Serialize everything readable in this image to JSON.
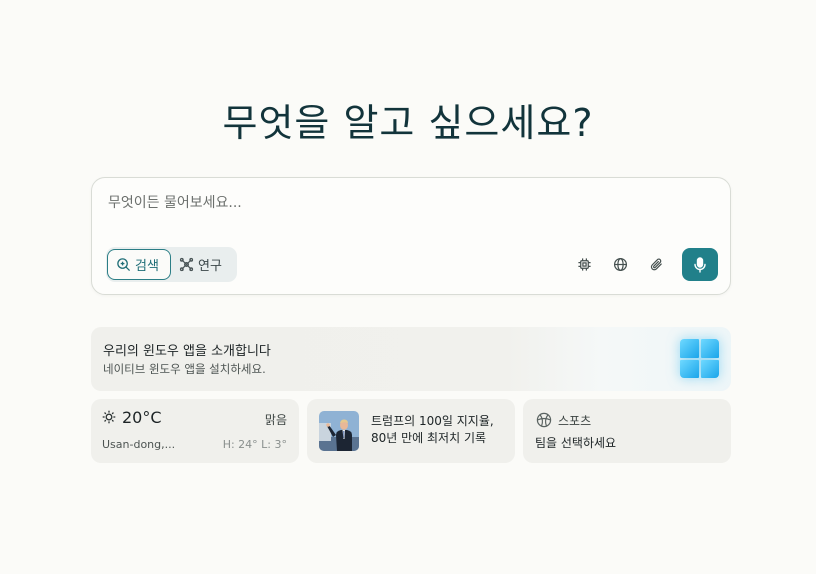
{
  "hero": {
    "title": "무엇을 알고 싶으세요?"
  },
  "composer": {
    "placeholder": "무엇이든 물어보세요...",
    "modes": [
      {
        "label": "검색",
        "icon": "search-icon",
        "active": true
      },
      {
        "label": "연구",
        "icon": "research-icon",
        "active": false
      }
    ],
    "tools": [
      "chip-icon",
      "globe-icon",
      "paperclip-icon"
    ],
    "mic_icon": "microphone-icon",
    "accent_color": "#21808a"
  },
  "promo": {
    "title": "우리의 윈도우 앱을 소개합니다",
    "subtitle": "네이티브 윈도우 앱을 설치하세요.",
    "icon": "windows-logo-icon"
  },
  "weather": {
    "icon": "sun-icon",
    "temperature": "20°C",
    "condition": "맑음",
    "location": "Usan-dong,...",
    "high_low": "H: 24° L: 3°"
  },
  "news": {
    "headline": "트럼프의 100일 지지율, 80년 만에 최저치 기록"
  },
  "sports": {
    "icon": "basketball-icon",
    "label": "스포츠",
    "text": "팀을 선택하세요"
  }
}
